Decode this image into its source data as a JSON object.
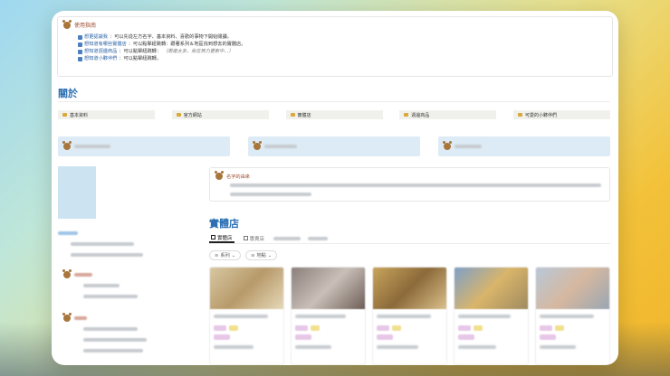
{
  "guide": {
    "title": "使用指南",
    "lines": [
      {
        "link": "想更認識我",
        "rest": "：可以先從左方名字、基本資料、喜歡的事物下開始閱讀。"
      },
      {
        "link": "想知道有哪些實體店",
        "rest": "：可以點擊紐跳轉：跟著系列＆地區找到想去的實體店。"
      },
      {
        "link": "想知道週邊商品",
        "rest": "：可以點擊紐跳轉：",
        "note": "（周邊太多，尚在努力更新中...）"
      },
      {
        "link": "想知道小夥伴們",
        "rest": "：可以點擊紐跳轉。"
      }
    ]
  },
  "about": {
    "heading": "關於",
    "tabs": [
      "基本資料",
      "官方網站",
      "實體店",
      "週邊商品",
      "可愛的小夥伴們"
    ]
  },
  "name_origin": {
    "title": "名字的由來"
  },
  "stores": {
    "heading": "實體店",
    "view_tabs": [
      "實體店",
      "專賣店"
    ],
    "filters": [
      "系列",
      "地點"
    ]
  },
  "colors": {
    "accent_blue": "#2c6fb3",
    "title_brown": "#9b4a2c",
    "card_blue": "#dcebf5"
  }
}
